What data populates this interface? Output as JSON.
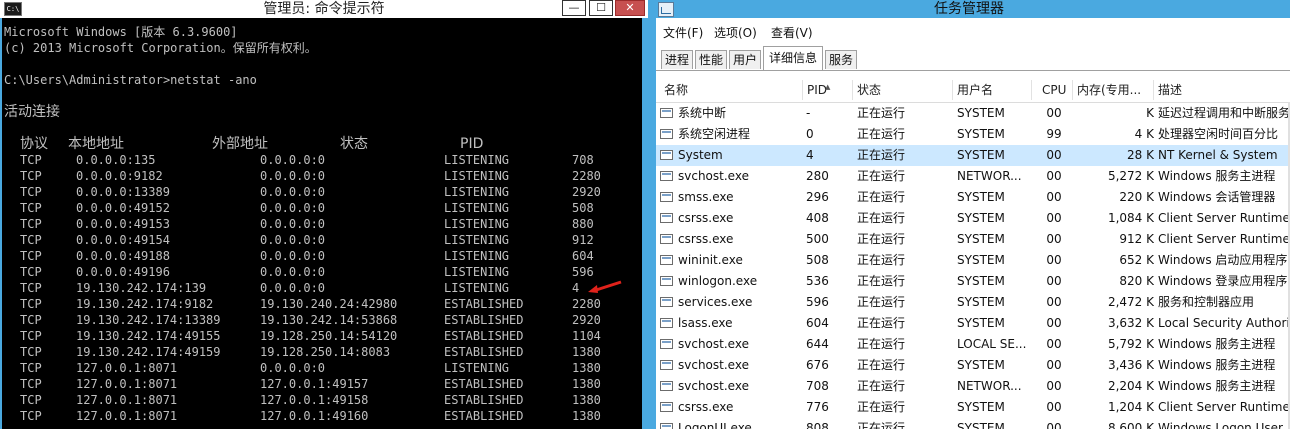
{
  "cmd": {
    "title": "管理员: 命令提示符",
    "icon_label": "C:\\",
    "buttons": {
      "minimize": "—",
      "maximize": "☐",
      "close": "✕"
    },
    "lines": {
      "version": "Microsoft Windows [版本 6.3.9600]",
      "copyright": "(c) 2013 Microsoft Corporation。保留所有权利。",
      "prompt": "C:\\Users\\Administrator>netstat -ano",
      "active": "活动连接"
    },
    "headers": [
      "协议",
      "本地地址",
      "外部地址",
      "状态",
      "PID"
    ],
    "connections": [
      [
        "TCP",
        "0.0.0.0:135",
        "0.0.0.0:0",
        "LISTENING",
        "708"
      ],
      [
        "TCP",
        "0.0.0.0:9182",
        "0.0.0.0:0",
        "LISTENING",
        "2280"
      ],
      [
        "TCP",
        "0.0.0.0:13389",
        "0.0.0.0:0",
        "LISTENING",
        "2920"
      ],
      [
        "TCP",
        "0.0.0.0:49152",
        "0.0.0.0:0",
        "LISTENING",
        "508"
      ],
      [
        "TCP",
        "0.0.0.0:49153",
        "0.0.0.0:0",
        "LISTENING",
        "880"
      ],
      [
        "TCP",
        "0.0.0.0:49154",
        "0.0.0.0:0",
        "LISTENING",
        "912"
      ],
      [
        "TCP",
        "0.0.0.0:49188",
        "0.0.0.0:0",
        "LISTENING",
        "604"
      ],
      [
        "TCP",
        "0.0.0.0:49196",
        "0.0.0.0:0",
        "LISTENING",
        "596"
      ],
      [
        "TCP",
        "19.130.242.174:139",
        "0.0.0.0:0",
        "LISTENING",
        "4"
      ],
      [
        "TCP",
        "19.130.242.174:9182",
        "19.130.240.24:42980",
        "ESTABLISHED",
        "2280"
      ],
      [
        "TCP",
        "19.130.242.174:13389",
        "19.130.242.14:53868",
        "ESTABLISHED",
        "2920"
      ],
      [
        "TCP",
        "19.130.242.174:49155",
        "19.128.250.14:54120",
        "ESTABLISHED",
        "1104"
      ],
      [
        "TCP",
        "19.130.242.174:49159",
        "19.128.250.14:8083",
        "ESTABLISHED",
        "1380"
      ],
      [
        "TCP",
        "127.0.0.1:8071",
        "0.0.0.0:0",
        "LISTENING",
        "1380"
      ],
      [
        "TCP",
        "127.0.0.1:8071",
        "127.0.0.1:49157",
        "ESTABLISHED",
        "1380"
      ],
      [
        "TCP",
        "127.0.0.1:8071",
        "127.0.0.1:49158",
        "ESTABLISHED",
        "1380"
      ],
      [
        "TCP",
        "127.0.0.1:8071",
        "127.0.0.1:49160",
        "ESTABLISHED",
        "1380"
      ]
    ],
    "arrow_color": "#e0221b"
  },
  "taskmgr": {
    "title": "任务管理器",
    "menu": [
      "文件(F)",
      "选项(O)",
      "查看(V)"
    ],
    "tabs": [
      "进程",
      "性能",
      "用户",
      "详细信息",
      "服务"
    ],
    "active_tab": "详细信息",
    "columns": [
      "名称",
      "PID",
      "状态",
      "用户名",
      "CPU",
      "内存(专用...",
      "描述"
    ],
    "selected_row": "System",
    "selection_color": "#cce8ff",
    "processes": [
      [
        "系统中断",
        "-",
        "正在运行",
        "SYSTEM",
        "00",
        "K",
        "延迟过程调用和中断服务"
      ],
      [
        "系统空闲进程",
        "0",
        "正在运行",
        "SYSTEM",
        "99",
        "4 K",
        "处理器空闲时间百分比"
      ],
      [
        "System",
        "4",
        "正在运行",
        "SYSTEM",
        "00",
        "28 K",
        "NT Kernel & System"
      ],
      [
        "svchost.exe",
        "280",
        "正在运行",
        "NETWOR...",
        "00",
        "5,272 K",
        "Windows 服务主进程"
      ],
      [
        "smss.exe",
        "296",
        "正在运行",
        "SYSTEM",
        "00",
        "220 K",
        "Windows 会话管理器"
      ],
      [
        "csrss.exe",
        "408",
        "正在运行",
        "SYSTEM",
        "00",
        "1,084 K",
        "Client Server Runtime"
      ],
      [
        "csrss.exe",
        "500",
        "正在运行",
        "SYSTEM",
        "00",
        "912 K",
        "Client Server Runtime"
      ],
      [
        "wininit.exe",
        "508",
        "正在运行",
        "SYSTEM",
        "00",
        "652 K",
        "Windows 启动应用程序"
      ],
      [
        "winlogon.exe",
        "536",
        "正在运行",
        "SYSTEM",
        "00",
        "820 K",
        "Windows 登录应用程序"
      ],
      [
        "services.exe",
        "596",
        "正在运行",
        "SYSTEM",
        "00",
        "2,472 K",
        "服务和控制器应用"
      ],
      [
        "lsass.exe",
        "604",
        "正在运行",
        "SYSTEM",
        "00",
        "3,632 K",
        "Local Security Authority"
      ],
      [
        "svchost.exe",
        "644",
        "正在运行",
        "LOCAL SE...",
        "00",
        "5,792 K",
        "Windows 服务主进程"
      ],
      [
        "svchost.exe",
        "676",
        "正在运行",
        "SYSTEM",
        "00",
        "3,436 K",
        "Windows 服务主进程"
      ],
      [
        "svchost.exe",
        "708",
        "正在运行",
        "NETWOR...",
        "00",
        "2,204 K",
        "Windows 服务主进程"
      ],
      [
        "csrss.exe",
        "776",
        "正在运行",
        "SYSTEM",
        "00",
        "1,204 K",
        "Client Server Runtime"
      ],
      [
        "LogonUI.exe",
        "808",
        "正在运行",
        "SYSTEM",
        "00",
        "8,600 K",
        "Windows Logon User"
      ]
    ]
  }
}
